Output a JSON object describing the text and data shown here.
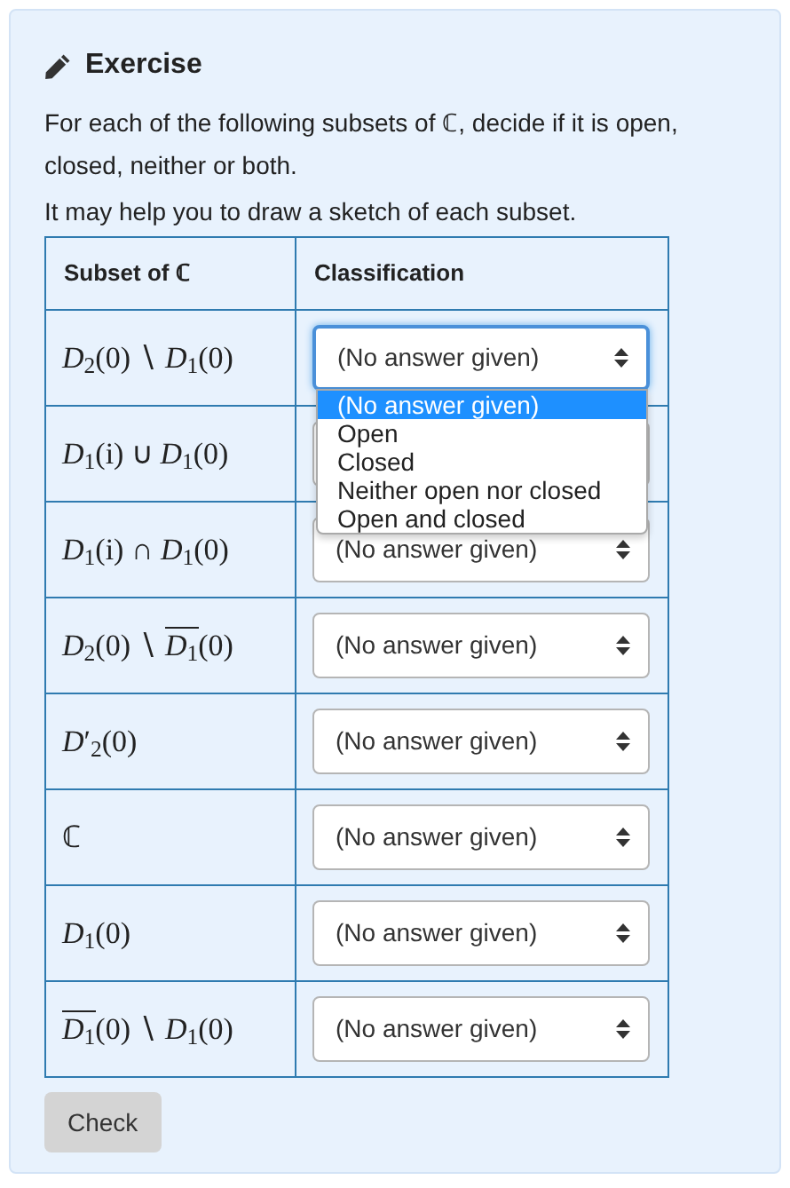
{
  "exercise": {
    "title": "Exercise",
    "paragraphs": [
      "For each of the following subsets of ℂ, decide if it is open, closed, neither or both.",
      "It may help you to draw a sketch of each subset."
    ],
    "table": {
      "columns": [
        "Subset of ℂ",
        "Classification"
      ],
      "rows": [
        {
          "subset": [
            {
              "t": "*D*$_{2}$(0) ∖ *D*$_{1}$(0)",
              "overline": false
            }
          ],
          "select": {
            "value": "(No answer given)",
            "focused": true,
            "expanded": true,
            "options": [
              {
                "label": "(No answer given)",
                "selected": true
              },
              {
                "label": "Open",
                "selected": false
              },
              {
                "label": "Closed",
                "selected": false
              },
              {
                "label": "Neither open nor closed",
                "selected": false
              },
              {
                "label": "Open and closed",
                "selected": false
              }
            ]
          }
        },
        {
          "subset": [
            {
              "t": "*D*$_{1}$(i) ∪ *D*$_{1}$(0)",
              "overline": false
            }
          ],
          "select": {
            "focused": false,
            "expanded": false
          }
        },
        {
          "subset": [
            {
              "t": "*D*$_{1}$(i) ∩ *D*$_{1}$(0)",
              "overline": false
            }
          ],
          "select": {
            "value": "(No answer given)",
            "focused": false,
            "expanded": false
          }
        },
        {
          "subset": [
            {
              "t": "*D*$_{2}$(0) ∖ ",
              "overline": false
            },
            {
              "t": "*D*$_{1}$",
              "overline": true
            },
            {
              "t": "(0)",
              "overline": false
            }
          ],
          "select": {
            "value": "(No answer given)",
            "focused": false,
            "expanded": false
          }
        },
        {
          "subset": [
            {
              "t": "*D*′$_{2}$(0)",
              "overline": false
            }
          ],
          "select": {
            "value": "(No answer given)",
            "focused": false,
            "expanded": false
          }
        },
        {
          "subset": [
            {
              "t": "ℂ",
              "overline": false
            }
          ],
          "select": {
            "value": "(No answer given)",
            "focused": false,
            "expanded": false
          }
        },
        {
          "subset": [
            {
              "t": "*D*$_{1}$(0)",
              "overline": false
            }
          ],
          "select": {
            "value": "(No answer given)",
            "focused": false,
            "expanded": false
          }
        },
        {
          "subset": [
            {
              "t": "*D*$_{1}$",
              "overline": true
            },
            {
              "t": "(0) ∖ *D*$_{1}$(0)",
              "overline": false
            }
          ],
          "select": {
            "value": "(No answer given)",
            "focused": false,
            "expanded": false
          }
        }
      ]
    },
    "button": "Check"
  }
}
